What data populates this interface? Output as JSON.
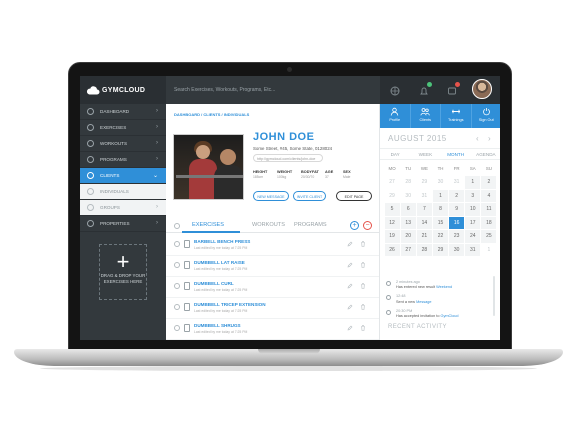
{
  "app": {
    "logo_text": "GYMCLOUD"
  },
  "search": {
    "placeholder": "Search Exercises, Workouts, Programs, Etc..."
  },
  "colors": {
    "accent": "#2f8fd8",
    "sidebar": "#33393d",
    "topbar": "#2a2f33",
    "badge_green": "#4cc37a",
    "badge_red": "#e5534b",
    "delete_red": "#e5534b"
  },
  "sidebar": {
    "items": [
      {
        "label": "DASHBOARD",
        "icon": "dashboard-icon"
      },
      {
        "label": "EXERCISES",
        "icon": "dumbbell-icon"
      },
      {
        "label": "WORKOUTS",
        "icon": "stopwatch-icon"
      },
      {
        "label": "PROGRAMS",
        "icon": "list-icon"
      },
      {
        "label": "CLIENTS",
        "icon": "user-icon"
      },
      {
        "label": "INDIVIDUALS",
        "icon": "person-icon"
      },
      {
        "label": "GROUPS",
        "icon": "group-icon"
      },
      {
        "label": "PROPERTIES",
        "icon": "gear-icon"
      }
    ],
    "dropzone": {
      "line1": "DRAG & DROP YOUR",
      "line2": "EXERCISES HERE"
    }
  },
  "breadcrumb": "DASHBOARD / CLIENTS / INDIVIDUALS",
  "profile": {
    "name": "JOHN DOE",
    "address": "Some Street, #45, Some State, 0128024",
    "website": "http://gymcloud.com/clients/john-doe",
    "stats": [
      {
        "label": "HEIGHT",
        "value": "185cm"
      },
      {
        "label": "WEIGHT",
        "value": "100kg"
      },
      {
        "label": "BODYFAT",
        "value": "20/30/70"
      },
      {
        "label": "AGE",
        "value": "37"
      },
      {
        "label": "SEX",
        "value": "Male"
      }
    ],
    "buttons": {
      "new_message": "NEW MESSAGE",
      "invite_client": "INVITE CLIENT",
      "edit_page": "EDIT PAGE"
    }
  },
  "tabs": [
    "EXERCISES",
    "WORKOUTS",
    "PROGRAMS"
  ],
  "exercises": [
    {
      "title": "BARBELL BENCH PRESS",
      "sub": "Last edited by me today at 7:25 PM"
    },
    {
      "title": "DUMBBELL LAT RAISE",
      "sub": "Last edited by me today at 7:25 PM"
    },
    {
      "title": "DUMBBELL CURL",
      "sub": "Last edited by me today at 7:25 PM"
    },
    {
      "title": "DUMBBELL TRICEP EXTENSION",
      "sub": "Last edited by me today at 7:25 PM"
    },
    {
      "title": "DUMBBELL SHRUGS",
      "sub": "Last edited by me today at 7:25 PM"
    }
  ],
  "actions": [
    "Profile",
    "Clients",
    "Trainings",
    "Sign Out"
  ],
  "calendar": {
    "month": "AUGUST 2015",
    "views": [
      "DAY",
      "WEEK",
      "MONTH",
      "AGENDA"
    ],
    "active_view": "MONTH",
    "weekdays": [
      "MO",
      "TU",
      "WE",
      "TH",
      "FR",
      "SA",
      "SU"
    ],
    "weeks": [
      [
        "27",
        "28",
        "29",
        "30",
        "31",
        "1",
        "2"
      ],
      [
        "29",
        "30",
        "31",
        "1",
        "2",
        "3",
        "4"
      ],
      [
        "5",
        "6",
        "7",
        "8",
        "9",
        "10",
        "11"
      ],
      [
        "12",
        "13",
        "14",
        "15",
        "16",
        "17",
        "18"
      ],
      [
        "19",
        "20",
        "21",
        "22",
        "23",
        "24",
        "25"
      ],
      [
        "26",
        "27",
        "28",
        "29",
        "30",
        "31",
        "1"
      ]
    ],
    "today": "16"
  },
  "feed": [
    {
      "time": "2 minutes ago",
      "text": "Has entered new result ",
      "highlight": "Weekend"
    },
    {
      "time": "12:48",
      "text": "Sent a new ",
      "highlight": "Message"
    },
    {
      "time": "20:30 PM",
      "text": "Has accepted invitation to ",
      "highlight": "GymCloud"
    }
  ],
  "recent_activity": "RECENT ACTIVITY"
}
